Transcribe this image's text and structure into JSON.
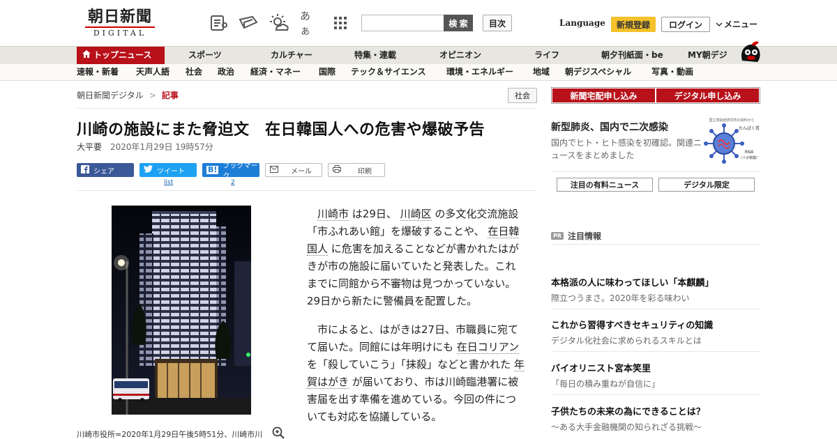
{
  "header": {
    "logo_main": "朝日新聞",
    "logo_sub": "DIGITAL",
    "icons": [
      "newspaper-icon",
      "shirt-icon",
      "weather-icon",
      "font-size-icon",
      "apps-grid-icon"
    ],
    "font_icon_text": "あぁ",
    "search_placeholder": "",
    "search_label": "検 索",
    "index_label": "目次",
    "language_label": "Language",
    "signup_label": "新規登録",
    "login_label": "ログイン",
    "menu_label": "メニュー"
  },
  "nav_primary": [
    {
      "label": "トップニュース",
      "active": true
    },
    {
      "label": "スポーツ"
    },
    {
      "label": "カルチャー"
    },
    {
      "label": "特集・連載"
    },
    {
      "label": "オピニオン"
    },
    {
      "label": "ライフ"
    },
    {
      "label": "朝夕刊紙面・be"
    },
    {
      "label": "MY朝デジ"
    }
  ],
  "nav_secondary": [
    "速報・新着",
    "天声人語",
    "社会",
    "政治",
    "経済・マネー",
    "国際",
    "テック＆サイエンス",
    "環境・エネルギー",
    "地域",
    "朝デジスペシャル",
    "写真・動画"
  ],
  "breadcrumb": {
    "home": "朝日新聞デジタル",
    "current": "記事"
  },
  "article": {
    "category": "社会",
    "headline": "川崎の施設にまた脅迫文　在日韓国人への危害や爆破予告",
    "author": "大平要",
    "date": "2020年1月29日 19時57分",
    "share": {
      "facebook": "シェア",
      "twitter": "ツイート",
      "twitter_count": "list",
      "hatena": "ブックマーク",
      "hatena_count": "2",
      "mail": "メール",
      "print": "印刷"
    },
    "photo_caption": "川崎市役所=2020年1月29日午後5時51分、川崎市川",
    "paragraph1": {
      "kw1": "川崎市",
      "t1": " は29日、 ",
      "kw2": "川崎区",
      "t2": " の多文化交流施設「市ふれあい館」を爆破することや、 ",
      "kw3": "在日韓国人",
      "t3": " に危害を加えることなどが書かれたはがきが市の施設に届いていたと発表した。これまでに同館から不審物は見つかっていない。29日から新たに警備員を配置した。"
    },
    "paragraph2": {
      "t1": "市によると、はがきは27日、市職員に宛てて届いた。同館には年明けにも ",
      "kw1": "在日コリアン",
      "t2": " を「殺していこう」「抹殺」などと書かれた ",
      "kw2": "年賀はがき",
      "t3": " が届いており、市は川崎臨港署に被害届を出す準備を進めている。今回の件についても対応を協議している。"
    }
  },
  "sidebar": {
    "subscribe_paper": "新聞宅配申し込み",
    "subscribe_digital": "デジタル申し込み",
    "feature_title": "新型肺炎、国内で二次感染",
    "feature_text": "国内でヒト・ヒト感染を初確認。関連ニュースをまとめました",
    "feature_image_top": "国立感染症研究所の資料から",
    "feature_image_label1": "たんぱく質",
    "feature_image_label2": "RNA",
    "feature_image_label3": "（リボ核酸）",
    "tab_paid": "注目の有料ニュース",
    "tab_digital": "デジタル限定",
    "pr_badge": "PR",
    "pr_heading": "注目情報",
    "pr_items": [
      {
        "title": "本格派の人に味わってほしい「本麒麟」",
        "sub": "際立つうまさ。2020年を彩る味わい"
      },
      {
        "title": "これから習得すべきセキュリティの知識",
        "sub": "デジタル化社会に求められるスキルとは"
      },
      {
        "title": "バイオリニスト宮本笑里",
        "sub": "「毎日の積み重ねが自信に」"
      },
      {
        "title": "子供たちの未来の為にできることは？",
        "sub": "～ある大手金融機関の知られざる挑戦～"
      }
    ]
  },
  "colors": {
    "brand_red": "#b8111a",
    "signup_yellow": "#f5c22b",
    "facebook_blue": "#3b5998",
    "twitter_blue": "#1da1f2",
    "hatena_blue": "#1d7ed6"
  }
}
